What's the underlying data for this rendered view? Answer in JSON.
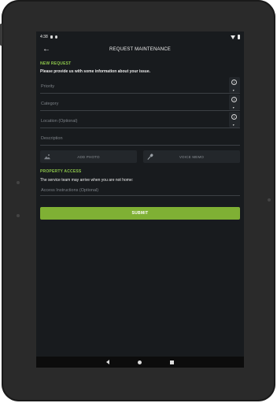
{
  "status_bar": {
    "time": "4:38"
  },
  "app_bar": {
    "title": "REQUEST MAINTENANCE"
  },
  "new_request": {
    "section_label": "NEW REQUEST",
    "intro": "Please provide us with some information about your issue.",
    "fields": {
      "priority": "Priority",
      "category": "Category",
      "location": "Location (Optional)",
      "description": "Description"
    },
    "add_photo_label": "ADD PHOTO",
    "voice_memo_label": "VOICE MEMO"
  },
  "property_access": {
    "section_label": "PROPERTY ACCESS",
    "note": "The service team may arrive when you are not home:",
    "access_instructions": "Access Instructions (Optional)"
  },
  "submit_label": "SUBMIT",
  "colors": {
    "accent": "#7fb034",
    "label_green": "#8bc34a",
    "background": "#181b1e"
  },
  "icons": [
    "back-arrow-icon",
    "info-icon",
    "photo-icon",
    "microphone-icon"
  ]
}
